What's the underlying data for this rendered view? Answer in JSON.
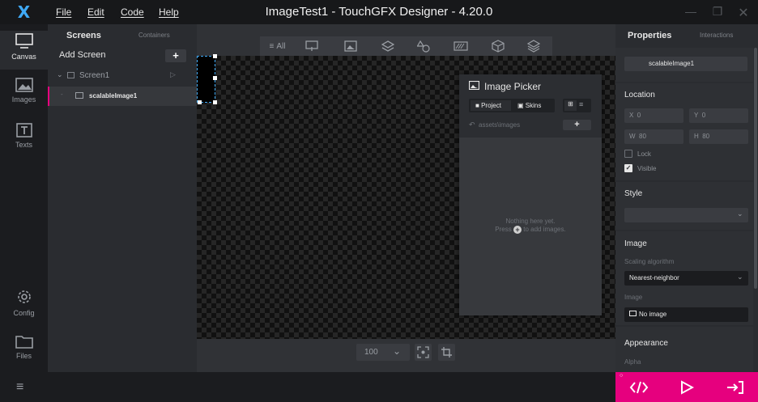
{
  "titlebar": {
    "menu": [
      "File",
      "Edit",
      "Code",
      "Help"
    ],
    "title": "ImageTest1 - TouchGFX Designer - 4.20.0",
    "controls": [
      "minimize-icon",
      "restore-icon",
      "close-icon"
    ]
  },
  "rail": {
    "items": [
      {
        "label": "Canvas",
        "icon": "monitor-icon"
      },
      {
        "label": "Images",
        "icon": "image-icon"
      },
      {
        "label": "Texts",
        "icon": "text-icon"
      },
      {
        "label": "Config",
        "icon": "gear-icon"
      },
      {
        "label": "Files",
        "icon": "folder-icon"
      }
    ]
  },
  "screens_panel": {
    "tab_screens": "Screens",
    "tab_containers": "Containers",
    "add_screen": "Add Screen",
    "add_symbol": "+",
    "screen_name": "Screen1",
    "widget_name": "scalableImage1"
  },
  "canvas_toolbar": {
    "all_label": "All",
    "tools": [
      "widget-pointer-icon",
      "image-icon",
      "layers-icon",
      "shapes-icon",
      "progress-icon",
      "container-icon",
      "stack-icon"
    ]
  },
  "zoom": {
    "value": "100"
  },
  "image_picker": {
    "title": "Image Picker",
    "tab_project": "Project",
    "tab_skins": "Skins",
    "path": "assets\\images",
    "plus": "+",
    "empty_line1": "Nothing here yet.",
    "empty_line2_a": "Press",
    "empty_line2_b": "to add images."
  },
  "properties": {
    "tab_properties": "Properties",
    "tab_interactions": "Interactions",
    "widget_name": "scalableImage1",
    "location_title": "Location",
    "x_label": "X",
    "x_value": "0",
    "y_label": "Y",
    "y_value": "0",
    "w_label": "W",
    "w_value": "80",
    "h_label": "H",
    "h_value": "80",
    "lock_label": "Lock",
    "lock_checked": false,
    "visible_label": "Visible",
    "visible_checked": true,
    "style_title": "Style",
    "image_title": "Image",
    "scaling_label": "Scaling algorithm",
    "scaling_value": "Nearest-neighbor",
    "image_label": "Image",
    "image_value": "No image",
    "appearance_title": "Appearance",
    "alpha_label": "Alpha"
  },
  "action_bar": {
    "code_icon": "code-icon",
    "run_icon": "play-icon",
    "export_icon": "export-icon",
    "accent": "#e6007e"
  },
  "colors": {
    "accent_pink": "#e6007e",
    "selection_blue": "#3fa9f5"
  }
}
